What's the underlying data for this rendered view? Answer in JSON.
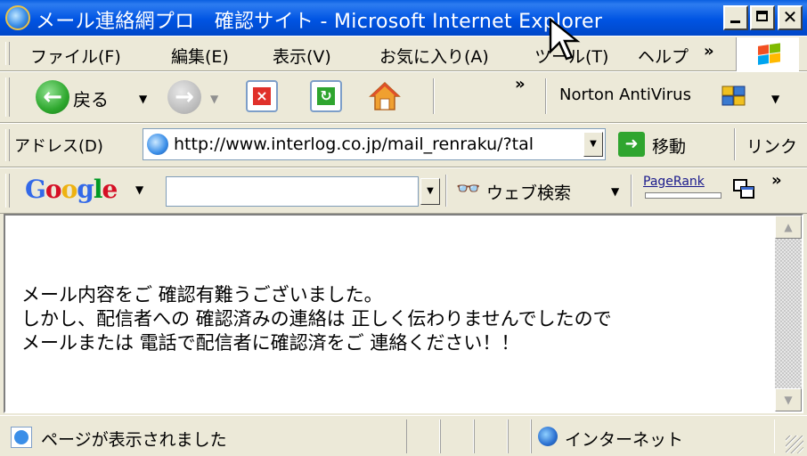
{
  "window": {
    "title": "メール連絡網プロ　確認サイト - Microsoft Internet Explorer"
  },
  "menu": {
    "items": [
      "ファイル(F)",
      "編集(E)",
      "表示(V)",
      "お気に入り(A)",
      "ツール(T)",
      "ヘルプ"
    ],
    "overflow": "»"
  },
  "toolbar": {
    "back_label": "戻る",
    "overflow": "»",
    "norton_label": "Norton AntiVirus"
  },
  "address": {
    "label": "アドレス(D)",
    "url": "http://www.interlog.co.jp/mail_renraku/?tal",
    "go_label": "移動",
    "links_label": "リンク"
  },
  "google": {
    "logo": [
      "G",
      "o",
      "o",
      "g",
      "l",
      "e"
    ],
    "search_value": "",
    "web_search_label": "ウェブ検索",
    "pagerank_label": "PageRank",
    "pagerank_level": 0.0,
    "overflow": "»"
  },
  "content": {
    "lines": [
      "メール内容をご 確認有難うございました。",
      "しかし、配信者への 確認済みの連絡は 正しく伝わりませんでしたので",
      "メールまたは 電話で配信者に確認済をご 連絡ください！！"
    ]
  },
  "status": {
    "text": "ページが表示されました",
    "zone": "インターネット"
  },
  "colors": {
    "titlebar": "#0054e3",
    "google_blue": "#3369e8",
    "google_red": "#d50f25",
    "google_yellow": "#eeb211",
    "google_green": "#009925"
  }
}
